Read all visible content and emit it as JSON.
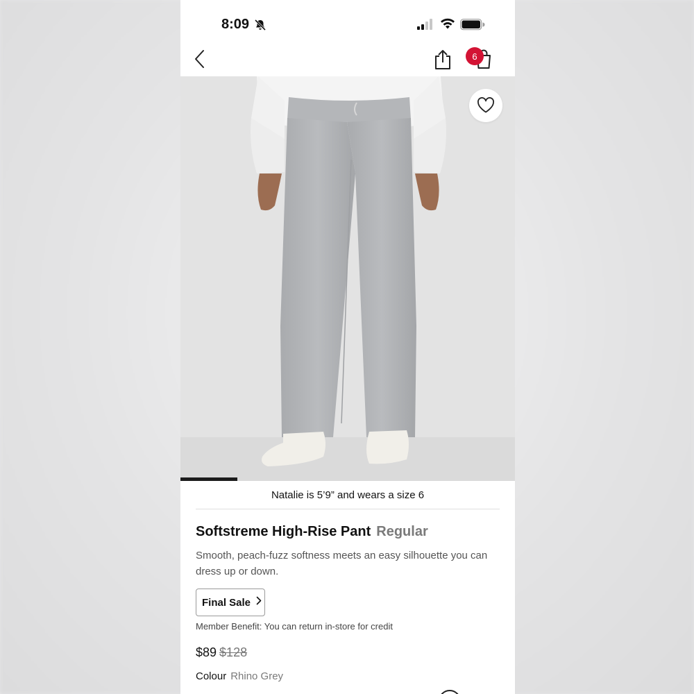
{
  "status_bar": {
    "time": "8:09",
    "icons": [
      "bell-slash-icon",
      "signal-icon",
      "wifi-icon",
      "battery-icon"
    ]
  },
  "nav": {
    "icons": [
      "back-chevron-icon",
      "share-icon",
      "shopping-bag-icon"
    ],
    "bag_count": "6",
    "badge_color": "#d31334"
  },
  "gallery": {
    "progress": 0.17,
    "caption": "Natalie is 5’9” and wears a size 6"
  },
  "product": {
    "name": "Softstreme High-Rise Pant",
    "fit": "Regular",
    "description": "Smooth, peach-fuzz softness meets an easy silhouette you can dress up or down.",
    "final_sale_label": "Final Sale",
    "member_benefit": "Member Benefit: You can return in-store for credit",
    "price": "$89",
    "original_price": "$128",
    "colour_label": "Colour",
    "colour_value": "Rhino Grey"
  }
}
